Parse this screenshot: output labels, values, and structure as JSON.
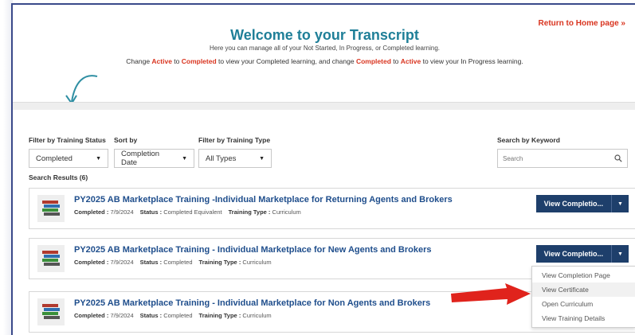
{
  "header": {
    "return_link": "Return to Home page »",
    "title": "Welcome to your Transcript",
    "subtitle": "Here you can manage all of your Not Started, In Progress, or Completed learning.",
    "instr_1": "Change ",
    "instr_active1": "Active",
    "instr_2": " to ",
    "instr_completed1": "Completed",
    "instr_3": " to view your Completed learning, and change ",
    "instr_completed2": "Completed",
    "instr_4": " to ",
    "instr_active2": "Active",
    "instr_5": " to view your In Progress learning."
  },
  "filters": {
    "status_label": "Filter by Training Status",
    "status_value": "Completed",
    "sort_label": "Sort by",
    "sort_value": "Completion Date",
    "type_label": "Filter by Training Type",
    "type_value": "All Types",
    "keyword_label": "Search by Keyword",
    "keyword_placeholder": "Search"
  },
  "results_label": "Search Results (6)",
  "meta_labels": {
    "completed": "Completed :",
    "status": "Status :",
    "type": "Training Type :"
  },
  "cards": [
    {
      "title": "PY2025 AB Marketplace Training -Individual Marketplace for Returning Agents and Brokers",
      "completed": "7/9/2024",
      "status": "Completed Equivalent",
      "type": "Curriculum",
      "button": "View Completio..."
    },
    {
      "title": "PY2025 AB Marketplace Training - Individual Marketplace for New Agents and Brokers",
      "completed": "7/9/2024",
      "status": "Completed",
      "type": "Curriculum",
      "button": "View Completio..."
    },
    {
      "title": "PY2025 AB Marketplace Training - Individual Marketplace for Non Agents and Brokers",
      "completed": "7/9/2024",
      "status": "Completed",
      "type": "Curriculum"
    }
  ],
  "menu": [
    "View Completion Page",
    "View Certificate",
    "Open Curriculum",
    "View Training Details"
  ],
  "colors": {
    "title": "#1f7f98",
    "accent_red": "#d9341f",
    "button": "#1e3f6b",
    "link": "#1f4e8c"
  },
  "icons": [
    "book-stack-icon",
    "search-icon",
    "caret-down-icon",
    "curved-arrow-icon",
    "red-arrow-icon"
  ]
}
